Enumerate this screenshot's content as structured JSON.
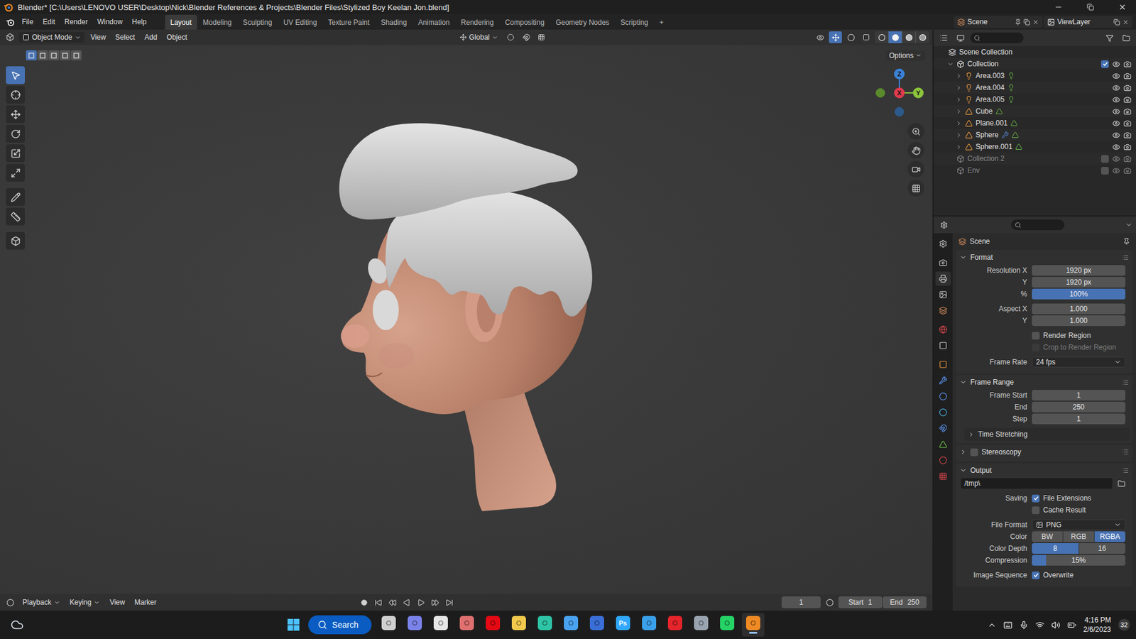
{
  "window": {
    "title": "Blender* [C:\\Users\\LENOVO USER\\Desktop\\Nick\\Blender References & Projects\\Blender Files\\Stylized Boy Keelan Jon.blend]"
  },
  "menu": [
    "File",
    "Edit",
    "Render",
    "Window",
    "Help"
  ],
  "workspaces": [
    {
      "label": "Layout",
      "selected": true
    },
    {
      "label": "Modeling",
      "selected": false
    },
    {
      "label": "Sculpting",
      "selected": false
    },
    {
      "label": "UV Editing",
      "selected": false
    },
    {
      "label": "Texture Paint",
      "selected": false
    },
    {
      "label": "Shading",
      "selected": false
    },
    {
      "label": "Animation",
      "selected": false
    },
    {
      "label": "Rendering",
      "selected": false
    },
    {
      "label": "Compositing",
      "selected": false
    },
    {
      "label": "Geometry Nodes",
      "selected": false
    },
    {
      "label": "Scripting",
      "selected": false
    }
  ],
  "add_workspace": "+",
  "scene": "Scene",
  "view_layer": "ViewLayer",
  "viewport_header": {
    "mode": "Object Mode",
    "menus": [
      "View",
      "Select",
      "Add",
      "Object"
    ],
    "orientation": "Global",
    "shading": [
      {
        "kind": "wireframe",
        "selected": false
      },
      {
        "kind": "solid",
        "selected": true
      },
      {
        "kind": "material",
        "selected": false
      },
      {
        "kind": "rendered",
        "selected": false
      }
    ]
  },
  "viewport": {
    "select_modes": [
      {
        "selected": true
      },
      {
        "selected": false
      },
      {
        "selected": false
      },
      {
        "selected": false
      },
      {
        "selected": false
      }
    ],
    "options": "Options",
    "tools": [
      {
        "kind": "select",
        "selected": true
      },
      {
        "kind": "cursor",
        "selected": false
      },
      {
        "kind": "move",
        "selected": false
      },
      {
        "kind": "rotate",
        "selected": false
      },
      {
        "kind": "scale",
        "selected": false
      },
      {
        "kind": "transform",
        "selected": false
      },
      {
        "kind": "annotate",
        "selected": false
      },
      {
        "kind": "measure",
        "selected": false
      },
      {
        "kind": "add-cube",
        "selected": false
      }
    ],
    "gizmo": [
      {
        "axis": "Z",
        "positive": false,
        "color": "#2d5a8c"
      },
      {
        "axis": "Y",
        "positive": false,
        "color": "#5b8a2c"
      },
      {
        "axis": "Z",
        "positive": true,
        "color": "#3b82d9"
      },
      {
        "axis": "Y",
        "positive": true,
        "color": "#8cc43c"
      },
      {
        "axis": "X",
        "positive": true,
        "color": "#e23a4e"
      }
    ]
  },
  "outliner": {
    "items": [
      {
        "name": "Scene Collection",
        "kind": "scene",
        "depth": 0,
        "expandable": false,
        "expanded": false,
        "checked": false,
        "excluded": false,
        "modifier": false
      },
      {
        "name": "Collection",
        "kind": "collection",
        "depth": 1,
        "expandable": true,
        "expanded": true,
        "checked": true,
        "excluded": false,
        "modifier": false
      },
      {
        "name": "Area.003",
        "kind": "light",
        "depth": 2,
        "expandable": true,
        "expanded": false,
        "checked": false,
        "excluded": false,
        "modifier": false
      },
      {
        "name": "Area.004",
        "kind": "light",
        "depth": 2,
        "expandable": true,
        "expanded": false,
        "checked": false,
        "excluded": false,
        "modifier": false
      },
      {
        "name": "Area.005",
        "kind": "light",
        "depth": 2,
        "expandable": true,
        "expanded": false,
        "checked": false,
        "excluded": false,
        "modifier": false
      },
      {
        "name": "Cube",
        "kind": "mesh",
        "depth": 2,
        "expandable": true,
        "expanded": false,
        "checked": false,
        "excluded": false,
        "modifier": false
      },
      {
        "name": "Plane.001",
        "kind": "mesh",
        "depth": 2,
        "expandable": true,
        "expanded": false,
        "checked": false,
        "excluded": false,
        "modifier": false
      },
      {
        "name": "Sphere",
        "kind": "mesh",
        "depth": 2,
        "expandable": true,
        "expanded": false,
        "checked": false,
        "excluded": false,
        "modifier": true
      },
      {
        "name": "Sphere.001",
        "kind": "mesh",
        "depth": 2,
        "expandable": true,
        "expanded": false,
        "checked": false,
        "excluded": false,
        "modifier": false
      },
      {
        "name": "Collection 2",
        "kind": "collection",
        "depth": 1,
        "expandable": false,
        "expanded": false,
        "checked": false,
        "excluded": true,
        "modifier": false
      },
      {
        "name": "Env",
        "kind": "collection",
        "depth": 1,
        "expandable": false,
        "expanded": false,
        "checked": false,
        "excluded": true,
        "modifier": false
      }
    ]
  },
  "properties": {
    "context": "Scene",
    "tabs": [
      {
        "kind": "tool",
        "selected": false
      },
      {
        "kind": "render",
        "selected": false
      },
      {
        "kind": "output",
        "selected": true
      },
      {
        "kind": "view-layer",
        "selected": false
      },
      {
        "kind": "scene",
        "selected": false
      },
      {
        "kind": "world",
        "selected": false
      },
      {
        "kind": "collection",
        "selected": false
      },
      {
        "kind": "object",
        "selected": false
      },
      {
        "kind": "modifier",
        "selected": false
      },
      {
        "kind": "particles",
        "selected": false
      },
      {
        "kind": "physics",
        "selected": false
      },
      {
        "kind": "constraints",
        "selected": false
      },
      {
        "kind": "data",
        "selected": false
      },
      {
        "kind": "material",
        "selected": false
      },
      {
        "kind": "texture",
        "selected": false
      }
    ],
    "sections": [
      {
        "title": "Format",
        "expanded": true,
        "subpanels": [],
        "groups": [
          [
            {
              "kind": "number",
              "label": "Resolution X",
              "value": "1920 px"
            },
            {
              "kind": "number",
              "label": "Y",
              "value": "1920 px"
            },
            {
              "kind": "slider",
              "label": "%",
              "value": "100%",
              "level": 1
            }
          ],
          [
            {
              "kind": "number",
              "label": "Aspect X",
              "value": "1.000"
            },
            {
              "kind": "number",
              "label": "Y",
              "value": "1.000"
            }
          ],
          [
            {
              "kind": "checkbox",
              "text": "Render Region",
              "checked": false,
              "disabled": false
            },
            {
              "kind": "checkbox",
              "text": "Crop to Render Region",
              "checked": false,
              "disabled": true
            }
          ],
          [
            {
              "kind": "dropdown",
              "label": "Frame Rate",
              "value": "24 fps"
            }
          ]
        ]
      },
      {
        "title": "Frame Range",
        "expanded": true,
        "subpanels": [
          {
            "title": "Time Stretching",
            "expanded": false
          }
        ],
        "groups": [
          [
            {
              "kind": "number",
              "label": "Frame Start",
              "value": "1"
            },
            {
              "kind": "number",
              "label": "End",
              "value": "250"
            },
            {
              "kind": "number",
              "label": "Step",
              "value": "1"
            }
          ]
        ]
      },
      {
        "title": "Stereoscopy",
        "expanded": false,
        "enabled": false,
        "subpanels": [],
        "groups": []
      },
      {
        "title": "Output",
        "expanded": true,
        "subpanels": [],
        "groups": [
          [
            {
              "kind": "path",
              "value": "/tmp\\"
            }
          ],
          [
            {
              "kind": "checkbox",
              "label": "Saving",
              "text": "File Extensions",
              "checked": true,
              "disabled": false
            },
            {
              "kind": "checkbox",
              "text": "Cache Result",
              "checked": false,
              "disabled": false
            }
          ],
          [
            {
              "kind": "format",
              "label": "File Format",
              "value": "PNG"
            },
            {
              "kind": "toggle",
              "label": "Color",
              "options": [
                {
                  "label": "BW",
                  "selected": false
                },
                {
                  "label": "RGB",
                  "selected": false
                },
                {
                  "label": "RGBA",
                  "selected": true
                }
              ]
            },
            {
              "kind": "toggle",
              "label": "Color Depth",
              "options": [
                {
                  "label": "8",
                  "selected": true
                },
                {
                  "label": "16",
                  "selected": false
                }
              ]
            },
            {
              "kind": "slider",
              "label": "Compression",
              "value": "15%",
              "level": 0.15
            }
          ],
          [
            {
              "kind": "checkbox",
              "label": "Image Sequence",
              "text": "Overwrite",
              "checked": true,
              "disabled": false
            }
          ]
        ]
      }
    ]
  },
  "timeline": {
    "menus": [
      "Playback",
      "Keying",
      "View",
      "Marker"
    ],
    "current_frame": "1",
    "start_label": "Start",
    "start": "1",
    "end_label": "End",
    "end": "250"
  },
  "taskbar": {
    "search": "Search",
    "apps": [
      {
        "kind": "taskview",
        "color": "#d0d0d0",
        "active": false
      },
      {
        "kind": "chat",
        "color": "#7b83eb",
        "active": false
      },
      {
        "kind": "media",
        "color": "#e6e6e6",
        "active": false
      },
      {
        "kind": "resolve",
        "color": "#e07070",
        "active": false
      },
      {
        "kind": "netflix",
        "color": "#e50914",
        "active": false
      },
      {
        "kind": "explorer",
        "color": "#f2c94c",
        "active": false
      },
      {
        "kind": "edge",
        "color": "#2ec4a6",
        "active": false
      },
      {
        "kind": "store",
        "color": "#4aa3f0",
        "active": false
      },
      {
        "kind": "terminal",
        "color": "#3b6fd8",
        "active": false
      },
      {
        "kind": "photoshop",
        "color": "#31a8ff",
        "active": false,
        "label": "Ps"
      },
      {
        "kind": "window",
        "color": "#3aa0ea",
        "active": false
      },
      {
        "kind": "opera",
        "color": "#e5242b",
        "active": false
      },
      {
        "kind": "settings",
        "color": "#9aa4b0",
        "active": false
      },
      {
        "kind": "whatsapp",
        "color": "#25d366",
        "active": false
      },
      {
        "kind": "blender",
        "color": "#f08a24",
        "active": true
      }
    ],
    "time": "4:16 PM",
    "date": "2/6/2023",
    "badge": "32"
  }
}
